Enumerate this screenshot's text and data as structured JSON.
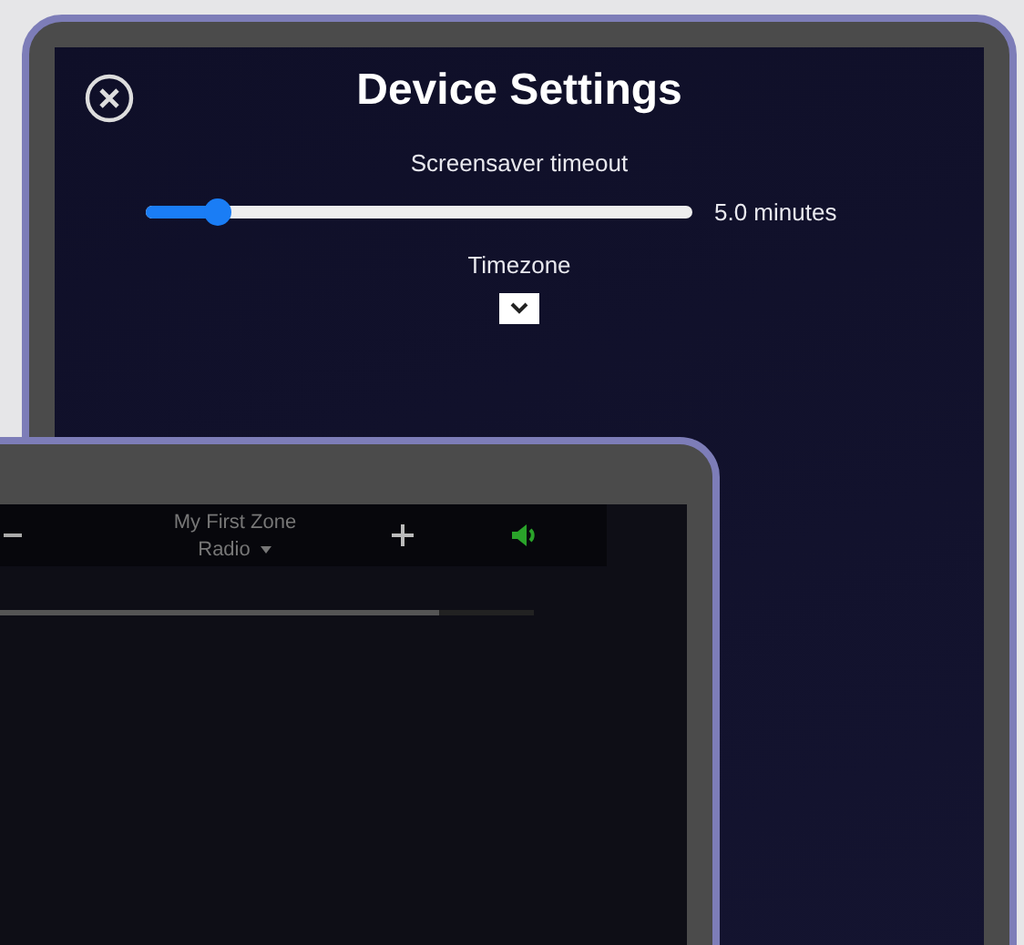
{
  "device_settings": {
    "title": "Device Settings",
    "screensaver": {
      "label": "Screensaver timeout",
      "level": 0.13,
      "reading": "5.0 minutes"
    },
    "timezone": {
      "label": "Timezone"
    }
  },
  "zone_bar": {
    "zone_name": "My First Zone",
    "source": "Radio",
    "muted": false,
    "level": 0.83
  }
}
